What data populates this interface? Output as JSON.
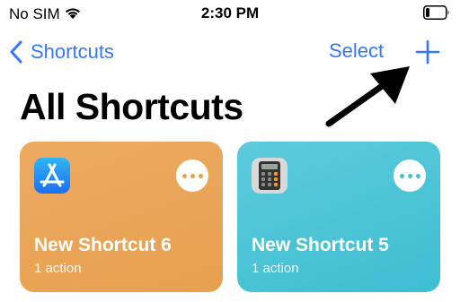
{
  "status_bar": {
    "carrier": "No SIM",
    "time": "2:30 PM",
    "wifi_icon": "wifi-icon",
    "battery_icon": "battery-icon"
  },
  "nav": {
    "back_label": "Shortcuts",
    "select_label": "Select",
    "add_icon": "plus-icon"
  },
  "page_title": "All Shortcuts",
  "colors": {
    "accent": "#3478f6",
    "card_orange": "#e8a04e",
    "card_teal": "#45c1d4"
  },
  "shortcuts": [
    {
      "title": "New Shortcut 6",
      "subtitle": "1 action",
      "icon": "app-store-icon",
      "color": "#e8a04e"
    },
    {
      "title": "New Shortcut 5",
      "subtitle": "1 action",
      "icon": "calculator-icon",
      "color": "#45c1d4"
    }
  ]
}
